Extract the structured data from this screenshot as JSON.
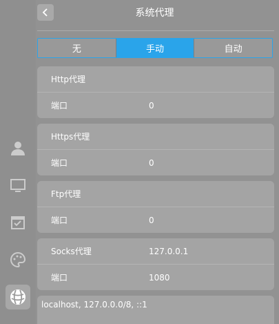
{
  "header": {
    "title": "系统代理",
    "back_icon": "chevron-left-icon"
  },
  "mode_tabs": [
    {
      "label": "无",
      "active": false
    },
    {
      "label": "手动",
      "active": true
    },
    {
      "label": "自动",
      "active": false
    }
  ],
  "http": {
    "title": "Http代理",
    "port_label": "端口",
    "port_value": "0"
  },
  "https": {
    "title": "Https代理",
    "port_label": "端口",
    "port_value": "0"
  },
  "ftp": {
    "title": "Ftp代理",
    "port_label": "端口",
    "port_value": "0"
  },
  "socks": {
    "title": "Socks代理",
    "host_value": "127.0.0.1",
    "port_label": "端口",
    "port_value": "1080"
  },
  "ignore_hosts": {
    "value": "localhost, 127.0.0.0/8, ::1"
  },
  "sidebar": {
    "icons": [
      "user-icon",
      "display-icon",
      "calendar-check-icon",
      "personalization-icon",
      "network-icon"
    ],
    "active": "network-icon"
  },
  "colors": {
    "accent": "#2aa4ea"
  }
}
